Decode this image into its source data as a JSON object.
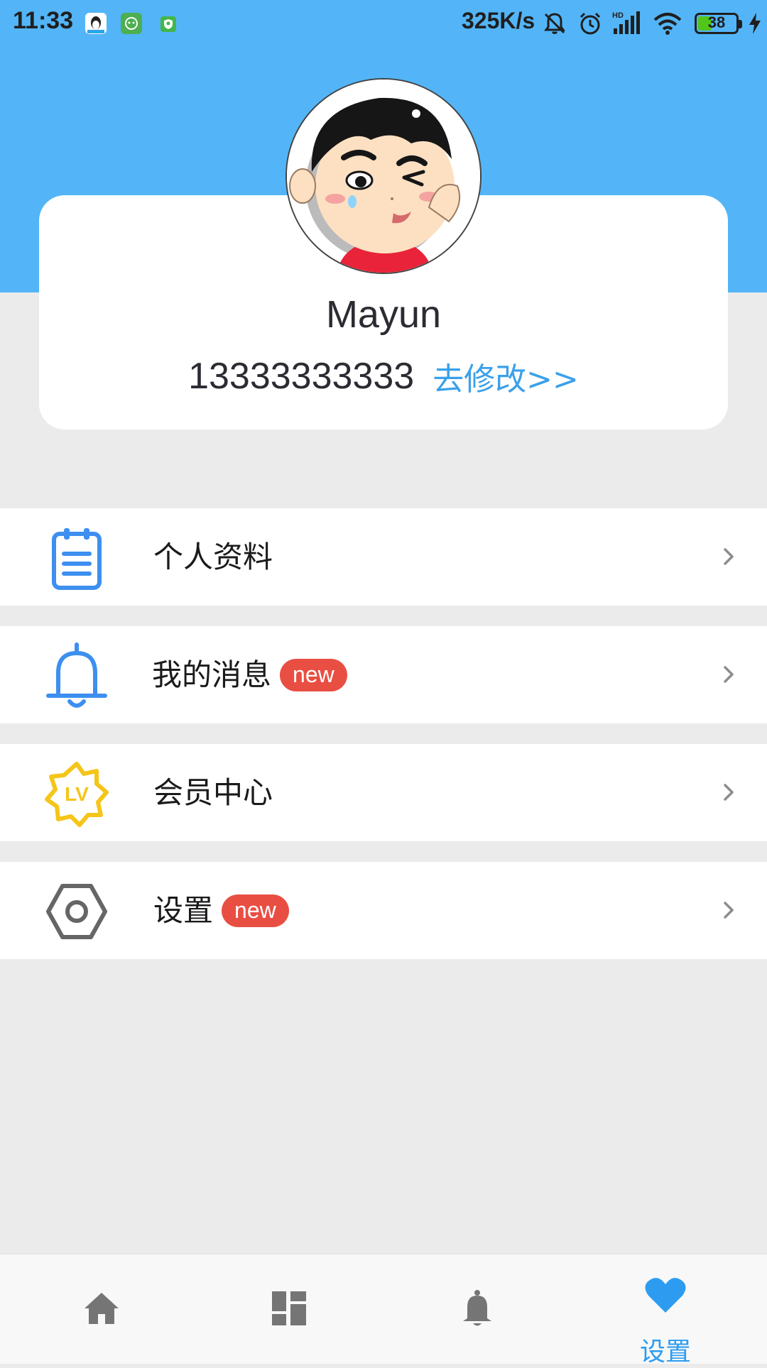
{
  "status_bar": {
    "time": "11:33",
    "net_speed": "325K/s",
    "battery_level": "38",
    "battery_fraction": 0.38
  },
  "profile": {
    "name": "Mayun",
    "phone": "13333333333",
    "edit_link": "去修改>>"
  },
  "menu": {
    "items": [
      {
        "label": "个人资料",
        "icon": "clipboard-icon"
      },
      {
        "label": "我的消息",
        "icon": "bell-icon",
        "badge": "new"
      },
      {
        "label": "会员中心",
        "icon": "vip-level-icon"
      },
      {
        "label": "设置",
        "icon": "settings-hexagon-icon",
        "badge": "new"
      }
    ]
  },
  "bottom_nav": {
    "tabs": [
      {
        "icon": "home-icon"
      },
      {
        "icon": "dashboard-icon"
      },
      {
        "icon": "bell-icon"
      },
      {
        "icon": "heart-icon",
        "label": "设置",
        "active": true
      }
    ]
  },
  "colors": {
    "header": "#53b5f7",
    "accent": "#3aa0ea",
    "badge": "#e94e43",
    "icon_gray": "#757575",
    "vip_yellow": "#f5c518"
  }
}
